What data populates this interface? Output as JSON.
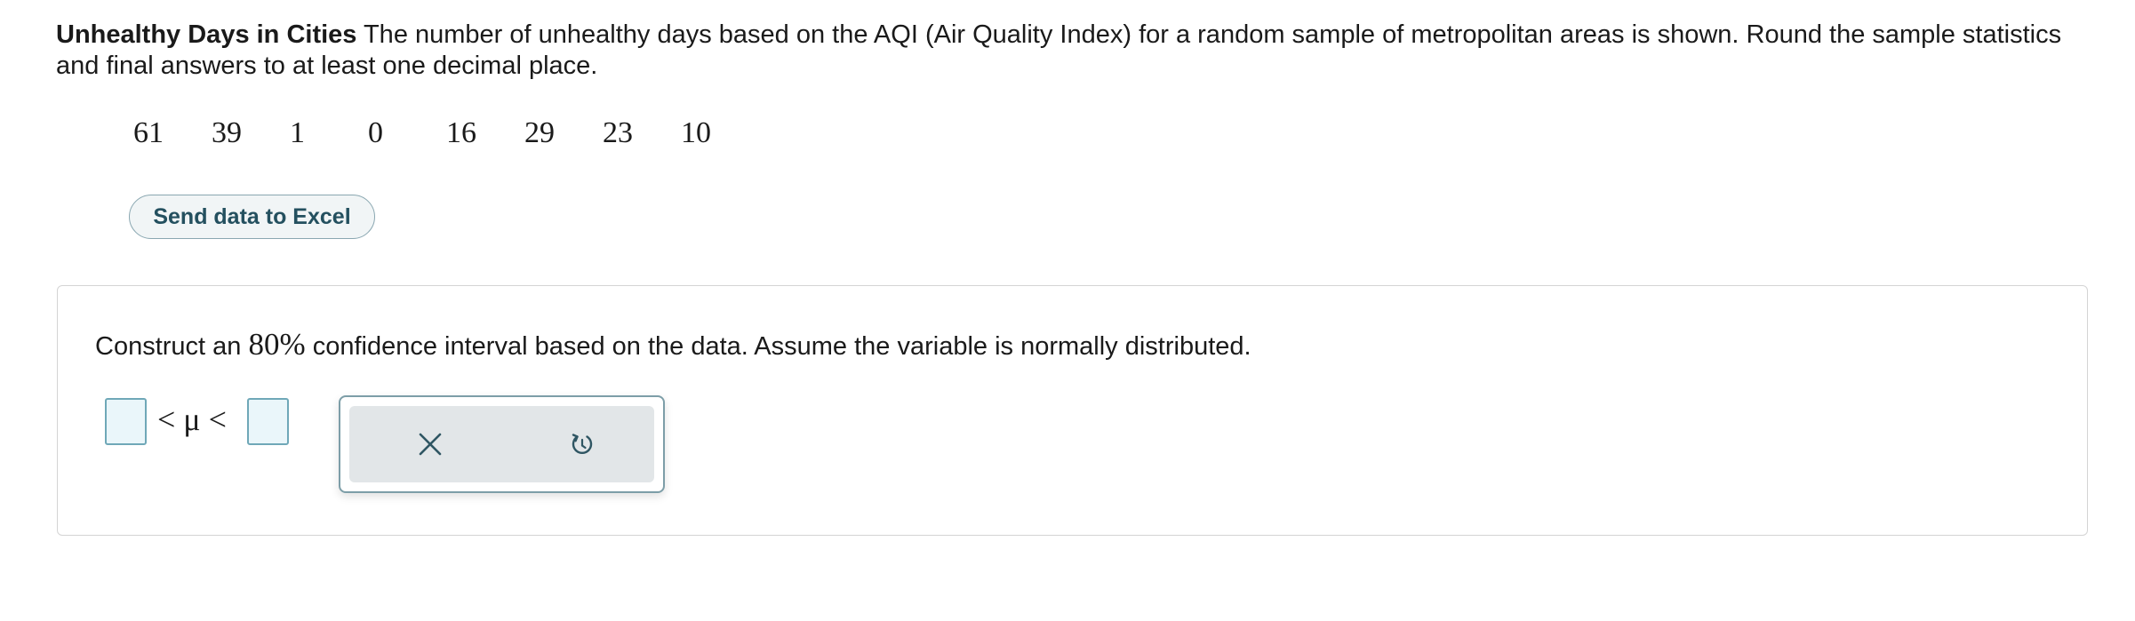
{
  "problem": {
    "title": "Unhealthy Days in Cities",
    "text": " The number of unhealthy days based on the AQI (Air Quality Index) for a random sample of metropolitan areas is shown. Round the sample statistics and final answers to at least one decimal place."
  },
  "data_values": [
    "61",
    "39",
    "1",
    "0",
    "16",
    "29",
    "23",
    "10"
  ],
  "excel_button": {
    "label": "Send data to Excel"
  },
  "question": {
    "prefix": "Construct an ",
    "percent": "80%",
    "suffix": " confidence interval based on the data. Assume the variable is normally distributed."
  },
  "answer": {
    "lower_value": "",
    "upper_value": "",
    "inequality": "< μ <"
  },
  "toolbar": {
    "clear_icon": "close-x-icon",
    "undo_icon": "undo-icon"
  },
  "colors": {
    "accent": "#24505f",
    "input_border": "#6fa8b8",
    "input_fill": "#eaf6fa",
    "toolbar_fill": "#e2e6e8"
  }
}
